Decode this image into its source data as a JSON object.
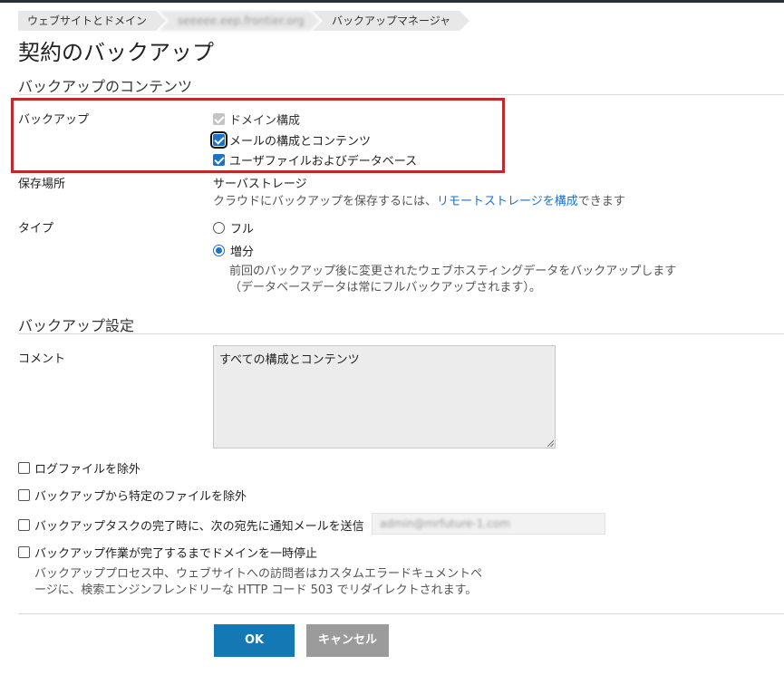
{
  "breadcrumb": {
    "items": [
      {
        "label": "ウェブサイトとドメイン"
      },
      {
        "label": "seeeee.eep.frontier.org"
      },
      {
        "label": "バックアップマネージャ"
      }
    ]
  },
  "page": {
    "title": "契約のバックアップ"
  },
  "contents_section": {
    "title": "バックアップのコンテンツ",
    "backup_label": "バックアップ",
    "options": [
      {
        "label": "ドメイン構成",
        "checked": true,
        "disabled": true
      },
      {
        "label": "メールの構成とコンテンツ",
        "checked": true,
        "disabled": false,
        "focused": true
      },
      {
        "label": "ユーザファイルおよびデータベース",
        "checked": true,
        "disabled": false
      }
    ],
    "storage_label": "保存場所",
    "storage_value": "サーバストレージ",
    "storage_hint_prefix": "クラウドにバックアップを保存するには、",
    "storage_hint_link": "リモートストレージを構成",
    "storage_hint_suffix": "できます",
    "type_label": "タイプ",
    "type_options": [
      {
        "label": "フル",
        "selected": false
      },
      {
        "label": "増分",
        "selected": true
      }
    ],
    "type_hint_line1": "前回のバックアップ後に変更されたウェブホスティングデータをバックアップします",
    "type_hint_line2": "（データベースデータは常にフルバックアップされます）。"
  },
  "settings_section": {
    "title": "バックアップ設定",
    "comment_label": "コメント",
    "comment_value": "すべての構成とコンテンツ",
    "exclude_logs": "ログファイルを除外",
    "exclude_files": "バックアップから特定のファイルを除外",
    "notify_label": "バックアップタスクの完了時に、次の宛先に通知メールを送信",
    "notify_email": "admin@mrfuture-1.com",
    "suspend_label": "バックアップ作業が完了するまでドメインを一時停止",
    "suspend_hint_line1": "バックアッププロセス中、ウェブサイトへの訪問者はカスタムエラードキュメントペ",
    "suspend_hint_line2": "ージに、検索エンジンフレンドリーな HTTP コード 503 でリダイレクトされます。"
  },
  "buttons": {
    "ok": "OK",
    "cancel": "キャンセル"
  },
  "colors": {
    "accent": "#1a73c8",
    "primary_button": "#1478b4",
    "secondary_button": "#9b9b9b",
    "highlight_box": "#c0282d"
  }
}
